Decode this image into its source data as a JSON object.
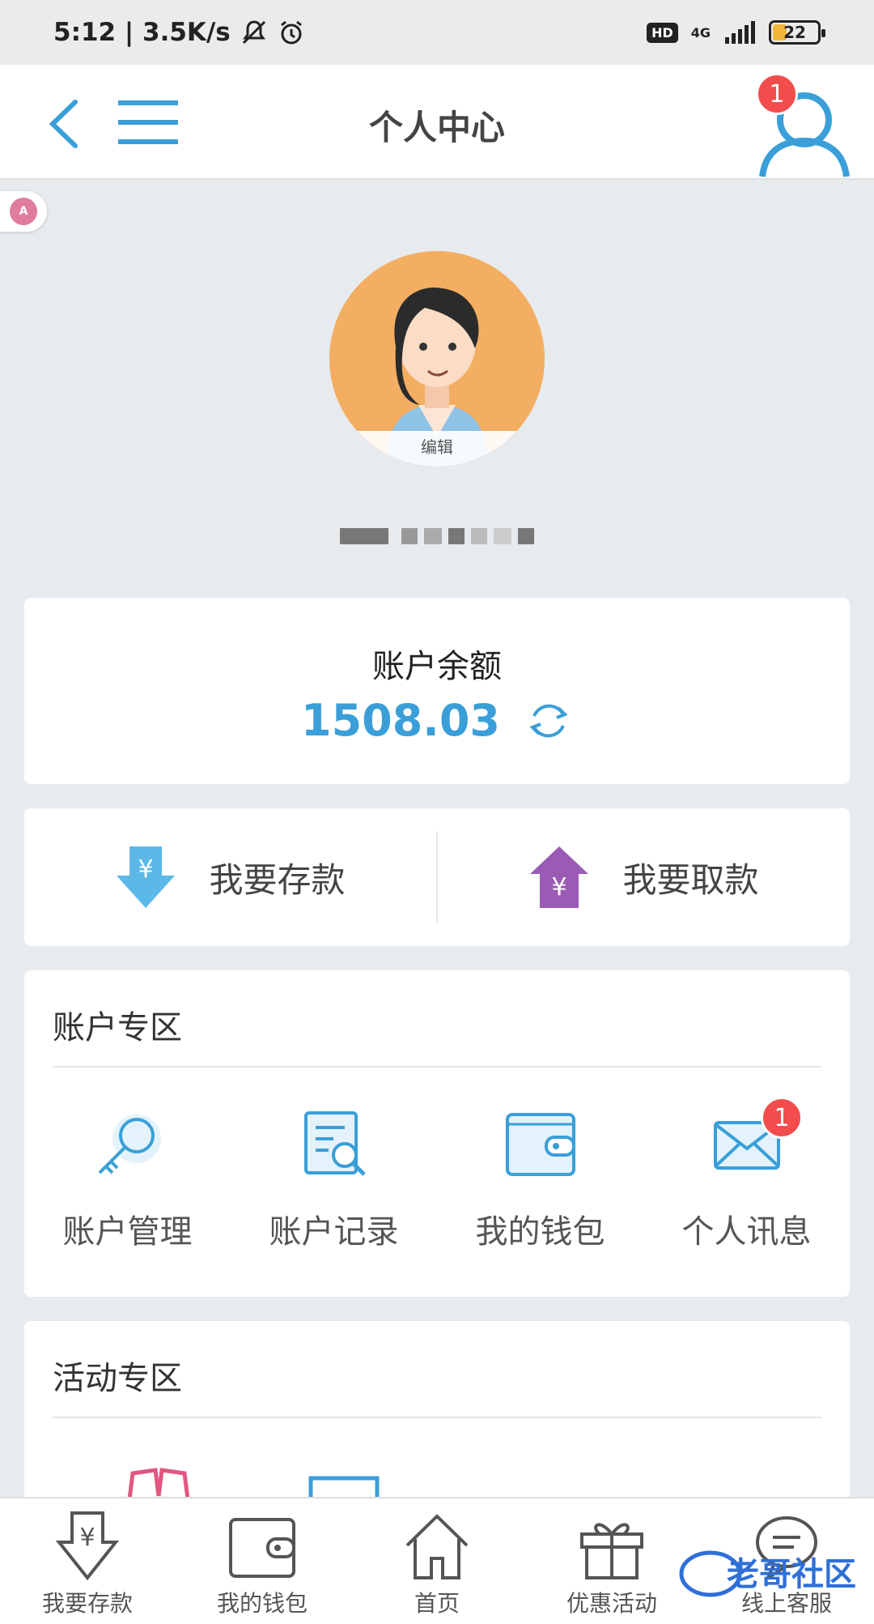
{
  "status_bar": {
    "time_speed": "5:12 | 3.5K/s",
    "network": "4G",
    "hd": "HD",
    "battery": "22"
  },
  "header": {
    "title": "个人中心",
    "badge": "1"
  },
  "profile": {
    "edit_label": "编辑"
  },
  "balance": {
    "label": "账户余额",
    "value": "1508.03"
  },
  "actions": {
    "deposit": "我要存款",
    "withdraw": "我要取款"
  },
  "account_zone": {
    "title": "账户专区",
    "items": [
      {
        "label": "账户管理",
        "icon": "key-icon"
      },
      {
        "label": "账户记录",
        "icon": "record-search-icon"
      },
      {
        "label": "我的钱包",
        "icon": "wallet-icon"
      },
      {
        "label": "个人讯息",
        "icon": "envelope-icon",
        "badge": "1"
      }
    ]
  },
  "activity_zone": {
    "title": "活动专区"
  },
  "bottom_nav": [
    {
      "label": "我要存款",
      "icon": "deposit-icon"
    },
    {
      "label": "我的钱包",
      "icon": "wallet-icon"
    },
    {
      "label": "首页",
      "icon": "home-icon"
    },
    {
      "label": "优惠活动",
      "icon": "gift-icon"
    },
    {
      "label": "线上客服",
      "icon": "chat-icon"
    }
  ],
  "watermark": "老哥社区",
  "colors": {
    "accent": "#3a9fd8",
    "badge": "#f24c4c",
    "background": "#e7ebee",
    "withdraw": "#9b5bb5"
  }
}
